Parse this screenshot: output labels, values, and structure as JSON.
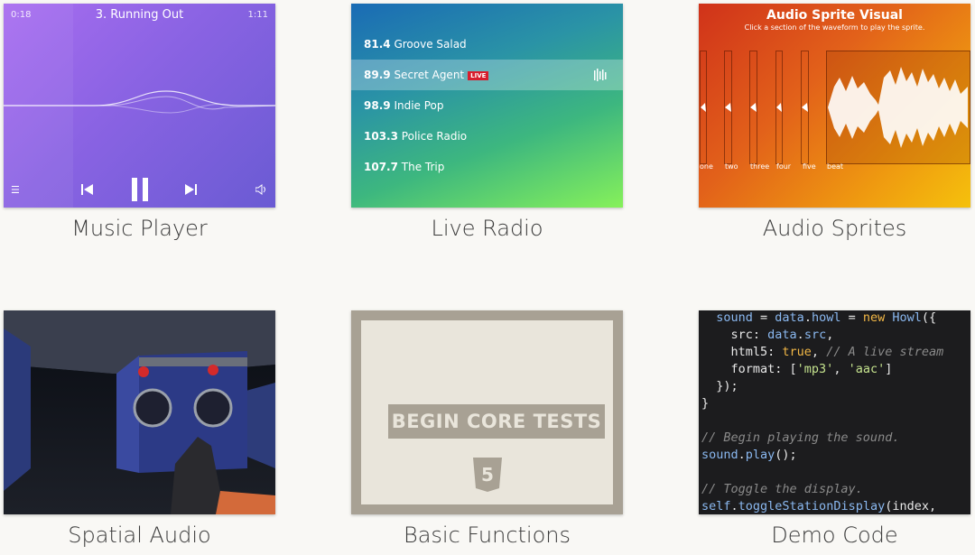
{
  "cards": [
    {
      "caption": "Music Player"
    },
    {
      "caption": "Live Radio"
    },
    {
      "caption": "Audio Sprites"
    },
    {
      "caption": "Spatial Audio"
    },
    {
      "caption": "Basic Functions"
    },
    {
      "caption": "Demo Code"
    }
  ],
  "player": {
    "elapsed": "0:18",
    "title": "3. Running Out",
    "duration": "1:11"
  },
  "radio": {
    "stations": [
      {
        "freq": "81.4",
        "name": "Groove Salad"
      },
      {
        "freq": "89.9",
        "name": "Secret Agent",
        "badge": "LIVE"
      },
      {
        "freq": "98.9",
        "name": "Indie Pop"
      },
      {
        "freq": "103.3",
        "name": "Police Radio"
      },
      {
        "freq": "107.7",
        "name": "The Trip"
      }
    ]
  },
  "sprites": {
    "title": "Audio Sprite Visual",
    "subtitle": "Click a section of the waveform to play the sprite.",
    "labels": [
      "one",
      "two",
      "three",
      "four",
      "five",
      "beat"
    ]
  },
  "basic": {
    "button": "BEGIN CORE TESTS",
    "html5_badge": "5"
  },
  "code": {
    "lines": [
      "  sound = data.howl = new Howl({",
      "    src: data.src,",
      "    html5: true, // A live stream",
      "    format: ['mp3', 'aac']",
      "  });",
      "}",
      "",
      "// Begin playing the sound.",
      "sound.play();",
      "",
      "// Toggle the display.",
      "self.toggleStationDisplay(index,"
    ]
  },
  "colors": {
    "live_badge": "#d81e2e",
    "code_keyword": "#f3b846",
    "code_property": "#8ab8f0",
    "code_string": "#c5e38e"
  }
}
